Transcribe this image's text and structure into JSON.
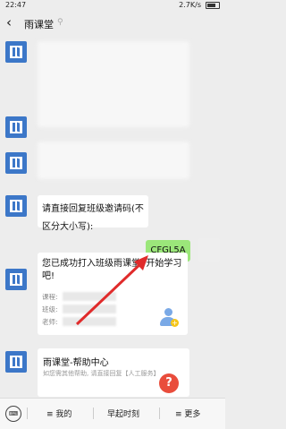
{
  "status": {
    "time": "22:47",
    "speed": "2.7K/s"
  },
  "nav": {
    "title": "雨课堂"
  },
  "messages": {
    "invite": "请直接回复班级邀请码(不区分大小写):",
    "code": "CFGL5A",
    "success": "您已成功打入班级雨课堂, 开始学习吧!",
    "course_label": "课程:",
    "class_label": "班级:",
    "teacher_label": "老师:"
  },
  "help": {
    "title": "雨课堂-帮助中心",
    "subtitle": "如您需其他帮助, 请直接回复【人工服务】",
    "icon": "question-icon"
  },
  "bottom": {
    "tab1": "≡ 我的",
    "tab2": "早起时刻",
    "tab3": "≡ 更多"
  },
  "colors": {
    "accent": "#3c77c8",
    "bubble_self": "#9be67a",
    "arrow": "#e02b2b"
  }
}
